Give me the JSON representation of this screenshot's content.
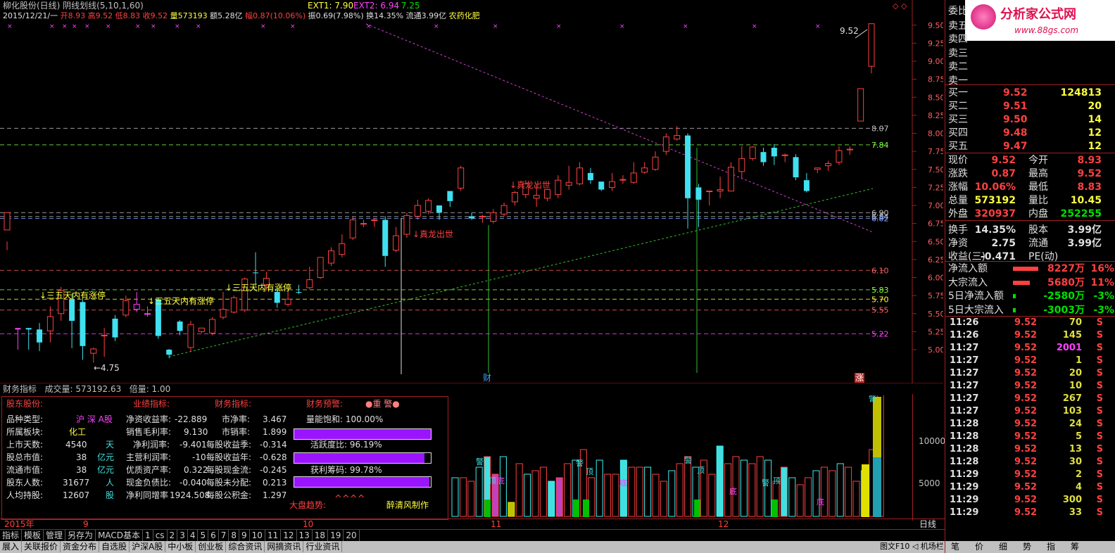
{
  "header": {
    "title": "柳化股份(日线) 阴线划线(5,10,1,60)",
    "ext1": "EXT1: 7.90",
    "ext2": "EXT2: 6.94",
    "ext3": ": 7.25",
    "date": "2015/12/21/一",
    "open": "开8.93",
    "high": "高9.52",
    "low": "低8.83",
    "close": "收9.52",
    "vol": "量573193",
    "amt": "额5.28亿",
    "pct": "幅0.87(10.06%)",
    "amp": "振0.69(7.98%)",
    "turn": "换14.35%",
    "float": "流通3.99亿",
    "sector": "农药化肥"
  },
  "price_axis": [
    "9.50",
    "9.25",
    "9.00",
    "8.75",
    "8.50",
    "8.25",
    "8.00",
    "7.75",
    "7.50",
    "7.25",
    "7.00",
    "6.75",
    "6.50",
    "6.25",
    "6.00",
    "5.75",
    "5.50",
    "5.25",
    "5.00"
  ],
  "level_labels": [
    {
      "text": "8.07",
      "color": "#c0c0c0",
      "price": 8.07
    },
    {
      "text": "7.84",
      "color": "#80ff40",
      "price": 7.84
    },
    {
      "text": "6.90",
      "color": "#c0c0c0",
      "price": 6.9
    },
    {
      "text": "6.84",
      "color": "#c0c0c0",
      "price": 6.845
    },
    {
      "text": "6.82",
      "color": "#80a0ff",
      "price": 6.82
    },
    {
      "text": "6.10",
      "color": "#ff6060",
      "price": 6.1
    },
    {
      "text": "5.83",
      "color": "#80ff40",
      "price": 5.83
    },
    {
      "text": "5.70",
      "color": "#ffff40",
      "price": 5.7
    },
    {
      "text": "5.55",
      "color": "#ff6060",
      "price": 5.55
    },
    {
      "text": "5.22",
      "color": "#ff40ff",
      "price": 5.22
    }
  ],
  "annotations": {
    "sanwu": "↓三五天内有涨停",
    "zhenlong": "↓真龙出世",
    "low_mark": "←4.75",
    "high_mark": "9.52",
    "cai": "财",
    "zhang": "涨"
  },
  "candles": [
    [
      6.66,
      6.9,
      6.5,
      6.38
    ],
    [
      5.3,
      5.28,
      5.3,
      5.0
    ],
    [
      5.3,
      5.28,
      5.3,
      5.0
    ],
    [
      5.28,
      5.1,
      5.37,
      4.98
    ],
    [
      5.26,
      5.46,
      5.6,
      5.1
    ],
    [
      5.5,
      5.82,
      5.87,
      5.4
    ],
    [
      5.7,
      5.4,
      5.78,
      5.02
    ],
    [
      5.66,
      5.05,
      5.7,
      4.86
    ],
    [
      4.95,
      5.01,
      5.03,
      4.82
    ],
    [
      5.2,
      5.2,
      5.3,
      4.9
    ],
    [
      5.43,
      5.17,
      5.48,
      5.12
    ],
    [
      5.48,
      5.68,
      5.75,
      5.45
    ],
    [
      5.56,
      5.63,
      5.8,
      5.52
    ],
    [
      5.5,
      5.5,
      5.6,
      5.46
    ],
    [
      5.7,
      5.19,
      5.72,
      5.15
    ],
    [
      5.0,
      4.93,
      5.01,
      4.88
    ],
    [
      5.39,
      5.26,
      5.41,
      5.2
    ],
    [
      5.03,
      5.35,
      5.4,
      4.98
    ],
    [
      5.25,
      5.3,
      5.3,
      5.23
    ],
    [
      5.23,
      5.42,
      5.45,
      5.2
    ],
    [
      5.45,
      5.56,
      5.8,
      5.42
    ],
    [
      5.52,
      5.72,
      5.75,
      5.5
    ],
    [
      5.55,
      5.98,
      6.0,
      5.52
    ],
    [
      6.07,
      6.06,
      6.35,
      5.88
    ],
    [
      5.9,
      5.99,
      6.08,
      5.82
    ],
    [
      5.8,
      5.65,
      5.86,
      5.58
    ],
    [
      5.63,
      5.7,
      5.86,
      5.6
    ],
    [
      5.8,
      5.79,
      5.9,
      5.77
    ],
    [
      5.86,
      5.97,
      6.15,
      5.84
    ],
    [
      6.0,
      6.28,
      6.28,
      5.98
    ],
    [
      6.2,
      6.37,
      6.42,
      6.16
    ],
    [
      6.32,
      6.47,
      6.6,
      6.28
    ],
    [
      6.55,
      6.8,
      6.84,
      6.52
    ],
    [
      6.75,
      6.75,
      6.8,
      6.7
    ],
    [
      6.8,
      6.8,
      6.82,
      6.7
    ],
    [
      6.8,
      6.3,
      6.85,
      6.15
    ],
    [
      6.38,
      6.58,
      6.7,
      6.35
    ],
    [
      6.6,
      6.86,
      6.9,
      6.55
    ],
    [
      6.85,
      7.0,
      7.08,
      6.8
    ],
    [
      6.92,
      7.07,
      7.1,
      6.88
    ],
    [
      7.0,
      6.9,
      7.0,
      6.8
    ],
    [
      7.2,
      7.06,
      7.2,
      6.98
    ],
    [
      7.24,
      7.52,
      7.55,
      7.2
    ],
    [
      6.85,
      6.82,
      6.9,
      6.8
    ],
    [
      6.85,
      6.85,
      6.87,
      6.76
    ],
    [
      6.78,
      6.9,
      6.95,
      6.75
    ],
    [
      6.88,
      7.0,
      7.04,
      6.85
    ],
    [
      7.05,
      7.18,
      7.2,
      7.0
    ],
    [
      7.15,
      7.3,
      7.35,
      7.1
    ],
    [
      7.1,
      7.14,
      7.3,
      6.98
    ],
    [
      7.1,
      7.22,
      7.22,
      7.06
    ],
    [
      7.15,
      7.35,
      7.42,
      7.1
    ],
    [
      7.28,
      7.32,
      7.55,
      7.22
    ],
    [
      7.3,
      7.52,
      7.6,
      7.28
    ],
    [
      7.45,
      7.35,
      7.52,
      7.3
    ],
    [
      7.33,
      7.22,
      7.33,
      7.2
    ],
    [
      7.25,
      7.33,
      7.45,
      7.2
    ],
    [
      7.36,
      7.36,
      7.42,
      7.3
    ],
    [
      7.32,
      7.45,
      7.6,
      7.3
    ],
    [
      7.46,
      7.52,
      7.6,
      7.44
    ],
    [
      7.5,
      7.67,
      7.75,
      7.48
    ],
    [
      7.75,
      7.95,
      8.0,
      7.7
    ],
    [
      7.92,
      7.97,
      8.1,
      7.9
    ],
    [
      7.97,
      7.1,
      8.0,
      6.68
    ],
    [
      7.25,
      7.08,
      7.3,
      6.7
    ],
    [
      7.2,
      7.2,
      7.2,
      7.0
    ],
    [
      7.2,
      7.22,
      7.4,
      7.1
    ],
    [
      7.2,
      7.53,
      7.6,
      7.2
    ],
    [
      7.47,
      7.65,
      7.82,
      7.38
    ],
    [
      7.65,
      7.81,
      7.82,
      7.62
    ],
    [
      7.74,
      7.6,
      7.8,
      7.55
    ],
    [
      7.8,
      7.68,
      7.85,
      7.56
    ],
    [
      7.7,
      7.7,
      7.72,
      7.6
    ],
    [
      7.67,
      7.39,
      7.71,
      7.35
    ],
    [
      7.35,
      7.2,
      7.45,
      7.18
    ],
    [
      7.5,
      7.52,
      7.52,
      7.45
    ],
    [
      7.55,
      7.58,
      7.62,
      7.48
    ],
    [
      7.6,
      7.76,
      7.82,
      7.56
    ],
    [
      7.78,
      7.78,
      7.82,
      7.7
    ],
    [
      8.17,
      8.62,
      8.62,
      8.17
    ],
    [
      8.93,
      9.52,
      9.52,
      8.83
    ]
  ],
  "volume_axis": [
    "10000",
    "5000"
  ],
  "fin": {
    "labels": {
      "gudong": "股东股份:",
      "yeji": "业绩指标:",
      "caiwu": "财务指标:",
      "yujing": "财务预警:",
      "zhongjing": "●重 警●",
      "pinzhong_l": "品种类型:",
      "pinzhong_v": "沪 深 A股",
      "bankuai_l": "所属板块:",
      "bankuai_v": "化工",
      "tianshu_l": "上市天数:",
      "tianshu_v": "4540",
      "tianshu_u": "天",
      "zongshi_l": "股总市值:",
      "zongshi_v": "38",
      "zongshi_u": "亿元",
      "liushi_l": "流通市值:",
      "liushi_v": "38",
      "liushi_u": "亿元",
      "renshu_l": "股东人数:",
      "renshu_v": "31677",
      "renshu_u": "人",
      "renjun_l": "人均持股:",
      "renjun_v": "12607",
      "renjun_u": "股",
      "jzc_l": "净资收益率:",
      "jzc_v": "-22.889",
      "mll_l": "销售毛利率:",
      "mll_v": "9.130",
      "jlr_l": "净利润率:",
      "jlr_v": "-9.401",
      "zylr_l": "主营利润率:",
      "zylr_v": "-10",
      "yxzc_l": "优质资产率:",
      "yxzc_v": "0.322",
      "xjfz_l": "现金负债比:",
      "xjfz_v": "-0.040",
      "jltz_l": "净利同增率",
      "jltz_v": "1924.508",
      "sjl_l": "市净率:",
      "sjl_v": "3.467",
      "sxl_l": "市销率:",
      "sxl_v": "1.899",
      "mgsyj_l": "每股收益季:",
      "mgsyj_v": "-0.314",
      "mgsyn_l": "每股收益年:",
      "mgsyn_v": "-0.628",
      "mgxjl_l": "每股现金流:",
      "mgxjl_v": "-0.245",
      "mgwfp_l": "每股未分配:",
      "mgwfp_v": "0.213",
      "mggjj_l": "每股公积金:",
      "mggjj_v": "1.297",
      "lnbh": "量能饱和: 100.00%",
      "hydb": "活跃度比: 96.19%",
      "hlcm": "获利筹码: 99.78%",
      "dpqs_l": "大盘趋势:",
      "dpqs_v": "^^^^",
      "author": "醉清风制作"
    },
    "bars": [
      {
        "pct": 1.0
      },
      {
        "pct": 0.9619
      },
      {
        "pct": 0.9978
      }
    ]
  },
  "sub_header": {
    "name": "财务指标",
    "vol": "成交量: 573192.63",
    "mult": "倍量: 1.00"
  },
  "timeline": {
    "year": "2015年",
    "m9": "9",
    "m10": "10",
    "m11": "11",
    "m12": "12",
    "period": "日线"
  },
  "tabs1": [
    "指标",
    "模板",
    "管理",
    "另存为",
    "MACD基本",
    "1",
    "cs",
    "2",
    "3",
    "4",
    "5",
    "6",
    "7",
    "8",
    "9",
    "10",
    "11",
    "12",
    "13",
    "18",
    "19",
    "20"
  ],
  "tabs2": [
    "展入",
    "关联报价",
    "资金分布",
    "自选股",
    "沪深A股",
    "中小板",
    "创业板",
    "综合资讯",
    "网摘资讯",
    "行业资讯"
  ],
  "status_right": "图文F10 ◁ 机场栏 ▷",
  "right": {
    "logo_title": "分析家公式网",
    "logo_url": "www.88gs.com",
    "weibi": "委比",
    "sell": [
      "卖五",
      "卖四",
      "卖三",
      "卖二",
      "卖一"
    ],
    "buy": [
      {
        "l": "买一",
        "p": "9.52",
        "v": "124813"
      },
      {
        "l": "买二",
        "p": "9.51",
        "v": "20"
      },
      {
        "l": "买三",
        "p": "9.50",
        "v": "14"
      },
      {
        "l": "买四",
        "p": "9.48",
        "v": "12"
      },
      {
        "l": "买五",
        "p": "9.47",
        "v": "12"
      }
    ],
    "quote": [
      {
        "a": "现价",
        "b": "9.52",
        "c": "今开",
        "d": "8.93",
        "bc": "#ff4040",
        "dc": "#ff4040"
      },
      {
        "a": "涨跌",
        "b": "0.87",
        "c": "最高",
        "d": "9.52",
        "bc": "#ff4040",
        "dc": "#ff4040"
      },
      {
        "a": "涨幅",
        "b": "10.06%",
        "c": "最低",
        "d": "8.83",
        "bc": "#ff4040",
        "dc": "#ff4040"
      },
      {
        "a": "总量",
        "b": "573192",
        "c": "量比",
        "d": "10.45",
        "bc": "#ffff40",
        "dc": "#ffff40"
      },
      {
        "a": "外盘",
        "b": "320937",
        "c": "内盘",
        "d": "252255",
        "bc": "#ff4040",
        "dc": "#00e000"
      },
      {
        "a": "换手",
        "b": "14.35%",
        "c": "股本",
        "d": "3.99亿",
        "bc": "#e0e0e0",
        "dc": "#e0e0e0"
      },
      {
        "a": "净资",
        "b": "2.75",
        "c": "流通",
        "d": "3.99亿",
        "bc": "#e0e0e0",
        "dc": "#e0e0e0"
      },
      {
        "a": "收益(三)",
        "b": "-0.471",
        "c": "PE(动)",
        "d": "",
        "bc": "#e0e0e0",
        "dc": "#e0e0e0"
      }
    ],
    "flow": [
      {
        "l": "净流入额",
        "v": "8227万",
        "p": "16%",
        "c": "#ff4040",
        "w": 0.9
      },
      {
        "l": "大宗流入",
        "v": "5680万",
        "p": "11%",
        "c": "#ff4040",
        "w": 0.6
      },
      {
        "l": "5日净流入额",
        "v": "-2580万",
        "p": "-3%",
        "c": "#00e000",
        "w": 0.1
      },
      {
        "l": "5日大宗流入",
        "v": "-3003万",
        "p": "-3%",
        "c": "#00e000",
        "w": 0.1
      }
    ],
    "ticks": [
      {
        "t": "11:26",
        "p": "9.52",
        "v": "70",
        "s": "S",
        "vc": "#e0e040"
      },
      {
        "t": "11:26",
        "p": "9.52",
        "v": "145",
        "s": "S",
        "vc": "#e0e040"
      },
      {
        "t": "11:27",
        "p": "9.52",
        "v": "2001",
        "s": "S",
        "vc": "#ff40ff"
      },
      {
        "t": "11:27",
        "p": "9.52",
        "v": "1",
        "s": "S",
        "vc": "#e0e040"
      },
      {
        "t": "11:27",
        "p": "9.52",
        "v": "20",
        "s": "S",
        "vc": "#e0e040"
      },
      {
        "t": "11:27",
        "p": "9.52",
        "v": "10",
        "s": "S",
        "vc": "#e0e040"
      },
      {
        "t": "11:27",
        "p": "9.52",
        "v": "267",
        "s": "S",
        "vc": "#e0e040"
      },
      {
        "t": "11:27",
        "p": "9.52",
        "v": "103",
        "s": "S",
        "vc": "#e0e040"
      },
      {
        "t": "11:28",
        "p": "9.52",
        "v": "24",
        "s": "S",
        "vc": "#e0e040"
      },
      {
        "t": "11:28",
        "p": "9.52",
        "v": "5",
        "s": "S",
        "vc": "#e0e040"
      },
      {
        "t": "11:28",
        "p": "9.52",
        "v": "13",
        "s": "S",
        "vc": "#e0e040"
      },
      {
        "t": "11:28",
        "p": "9.52",
        "v": "30",
        "s": "S",
        "vc": "#e0e040"
      },
      {
        "t": "11:29",
        "p": "9.52",
        "v": "2",
        "s": "S",
        "vc": "#e0e040"
      },
      {
        "t": "11:29",
        "p": "9.52",
        "v": "4",
        "s": "S",
        "vc": "#e0e040"
      },
      {
        "t": "11:29",
        "p": "9.52",
        "v": "300",
        "s": "S",
        "vc": "#e0e040"
      },
      {
        "t": "11:29",
        "p": "9.52",
        "v": "33",
        "s": "S",
        "vc": "#e0e040"
      }
    ],
    "bottom_tabs": [
      "笔",
      "价",
      "细",
      "势",
      "指",
      "筹"
    ]
  }
}
